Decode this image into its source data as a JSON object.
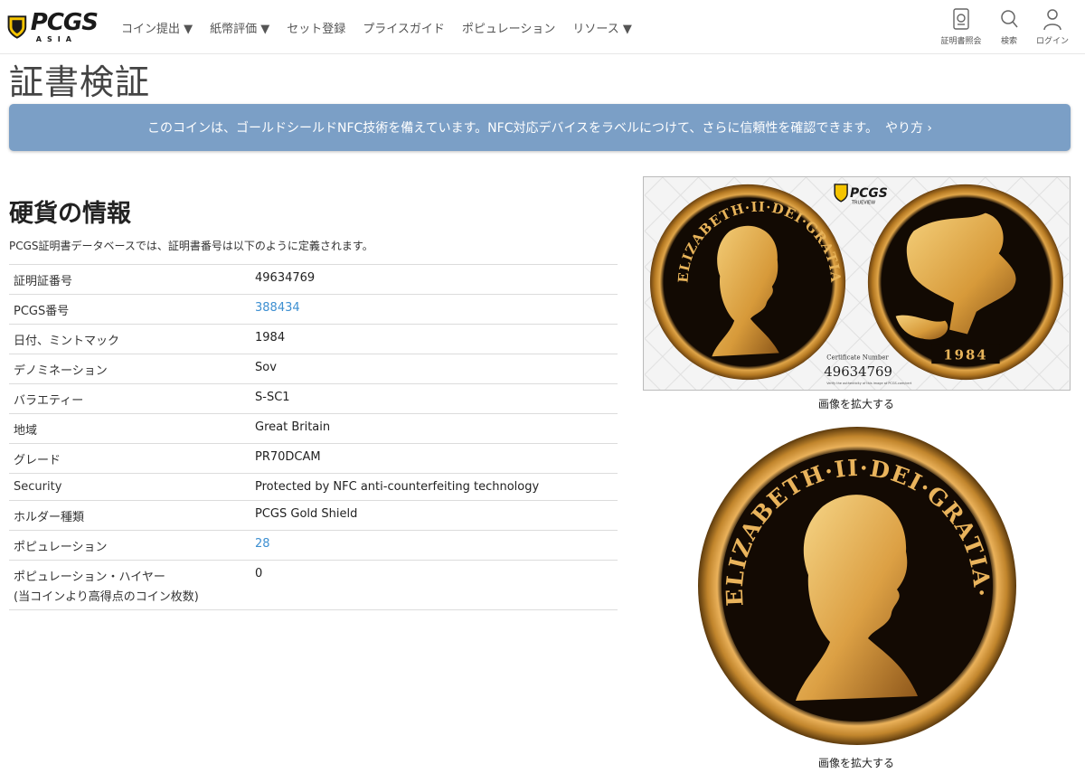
{
  "brand": {
    "logo_main": "PCGS",
    "logo_sub": "ASIA"
  },
  "nav": {
    "items": [
      "コイン提出 ▼",
      "紙幣評価 ▼",
      "セット登録",
      "プライスガイド",
      "ポピュレーション",
      "リソース ▼"
    ]
  },
  "utility": {
    "cert_lookup": "証明書照会",
    "search": "検索",
    "login": "ログイン"
  },
  "page": {
    "title": "証書検証"
  },
  "banner": {
    "text": "このコインは、ゴールドシールドNFC技術を備えています。NFC対応デバイスをラベルにつけて、さらに信頼性を確認できます。",
    "link": "やり方 ›"
  },
  "coin_info": {
    "title": "硬貨の情報",
    "description": "PCGS証明書データベースでは、証明書番号は以下のように定義されます。",
    "rows": [
      {
        "label": "証明証番号",
        "value": "49634769"
      },
      {
        "label": "PCGS番号",
        "value": "388434"
      },
      {
        "label": "日付、ミントマック",
        "value": "1984"
      },
      {
        "label": "デノミネーション",
        "value": "Sov"
      },
      {
        "label": "バラエティー",
        "value": "S-SC1"
      },
      {
        "label": "地域",
        "value": "Great Britain"
      },
      {
        "label": "グレード",
        "value": "PR70DCAM"
      },
      {
        "label": "Security",
        "value": "Protected by NFC anti-counterfeiting technology"
      },
      {
        "label": "ホルダー種類",
        "value": "PCGS Gold Shield"
      },
      {
        "label": "ポピュレーション",
        "value": "28"
      },
      {
        "label": "ポピュレーション・ハイヤー",
        "label_sub": "(当コインより高得点のコイン枚数)",
        "value": "0"
      }
    ]
  },
  "images": {
    "trueview": {
      "obverse_legend": "ELIZABETH·II·DEI·GRATIA·REGINA·F:D:",
      "badge": "PCGS",
      "badge_sub": "TRUEVIEW",
      "cert_label": "Certificate Number",
      "cert_number": "49634769",
      "verify_note": "Verify the authenticity of this image at PCGS.com/cert",
      "year": "1984"
    },
    "enlarge_label_1": "画像を拡大する",
    "enlarge_label_2": "画像を拡大する",
    "large_coin_legend": "ELIZABETH·II·DEI·GRATIA·REGINA·F:D:"
  },
  "colors": {
    "banner": "#7b9fc6",
    "link": "#3d8fd1",
    "logo_yellow": "#f5c400",
    "gold": "#c9902e"
  }
}
